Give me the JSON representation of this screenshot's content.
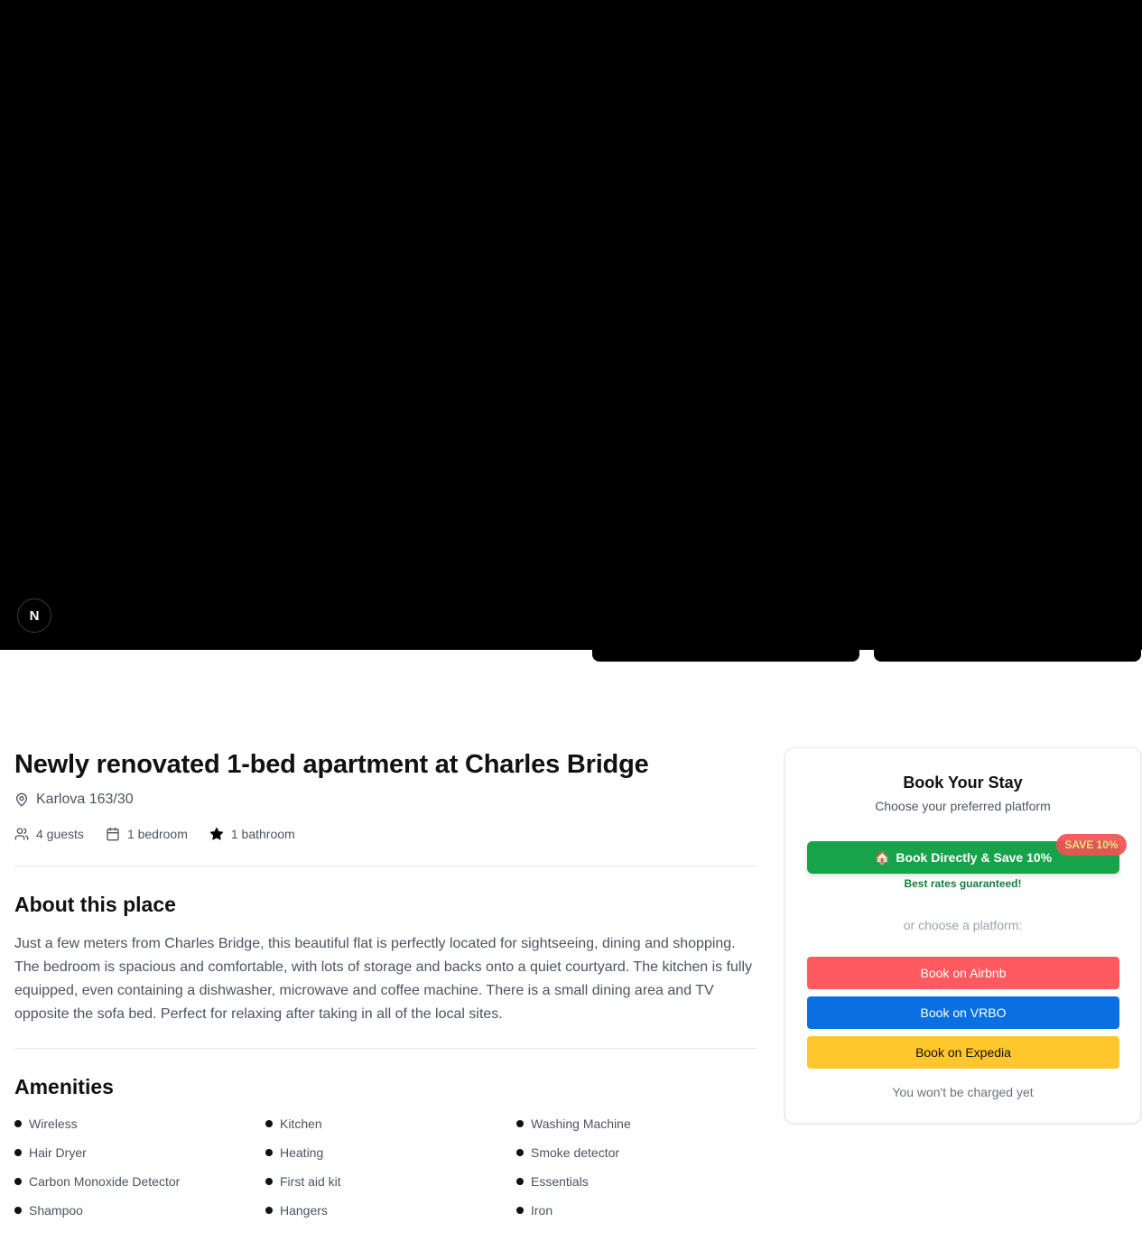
{
  "gallery": {
    "badge_letter": "N"
  },
  "listing": {
    "title": "Newly renovated 1-bed apartment at Charles Bridge",
    "address": "Karlova 163/30",
    "guests": "4 guests",
    "bedrooms": "1 bedroom",
    "bathrooms": "1 bathroom"
  },
  "about": {
    "heading": "About this place",
    "text": "Just a few meters from Charles Bridge, this beautiful flat is perfectly located for sightseeing, dining and shopping. The bedroom is spacious and comfortable, with lots of storage and backs onto a quiet courtyard. The kitchen is fully equipped, even containing a dishwasher, microwave and coffee machine. There is a small dining area and TV opposite the sofa bed. Perfect for relaxing after taking in all of the local sites."
  },
  "amenities": {
    "heading": "Amenities",
    "items": [
      "Wireless",
      "Kitchen",
      "Washing Machine",
      "Hair Dryer",
      "Heating",
      "Smoke detector",
      "Carbon Monoxide Detector",
      "First aid kit",
      "Essentials",
      "Shampoo",
      "Hangers",
      "Iron"
    ]
  },
  "booking": {
    "title": "Book Your Stay",
    "subtitle": "Choose your preferred platform",
    "direct_icon": "🏠",
    "direct_label": "Book Directly & Save 10%",
    "save_badge": "SAVE 10%",
    "best_rates": "Best rates guaranteed!",
    "or_text": "or choose a platform:",
    "airbnb_label": "Book on Airbnb",
    "vrbo_label": "Book on VRBO",
    "expedia_label": "Book on Expedia",
    "charged_note": "You won't be charged yet",
    "colors": {
      "direct": "#16a34a",
      "airbnb": "#ff5a5f",
      "vrbo": "#0a6fe0",
      "expedia": "#ffc72c"
    }
  },
  "icons": [
    "map-pin-icon",
    "users-icon",
    "calendar-icon",
    "star-icon"
  ]
}
